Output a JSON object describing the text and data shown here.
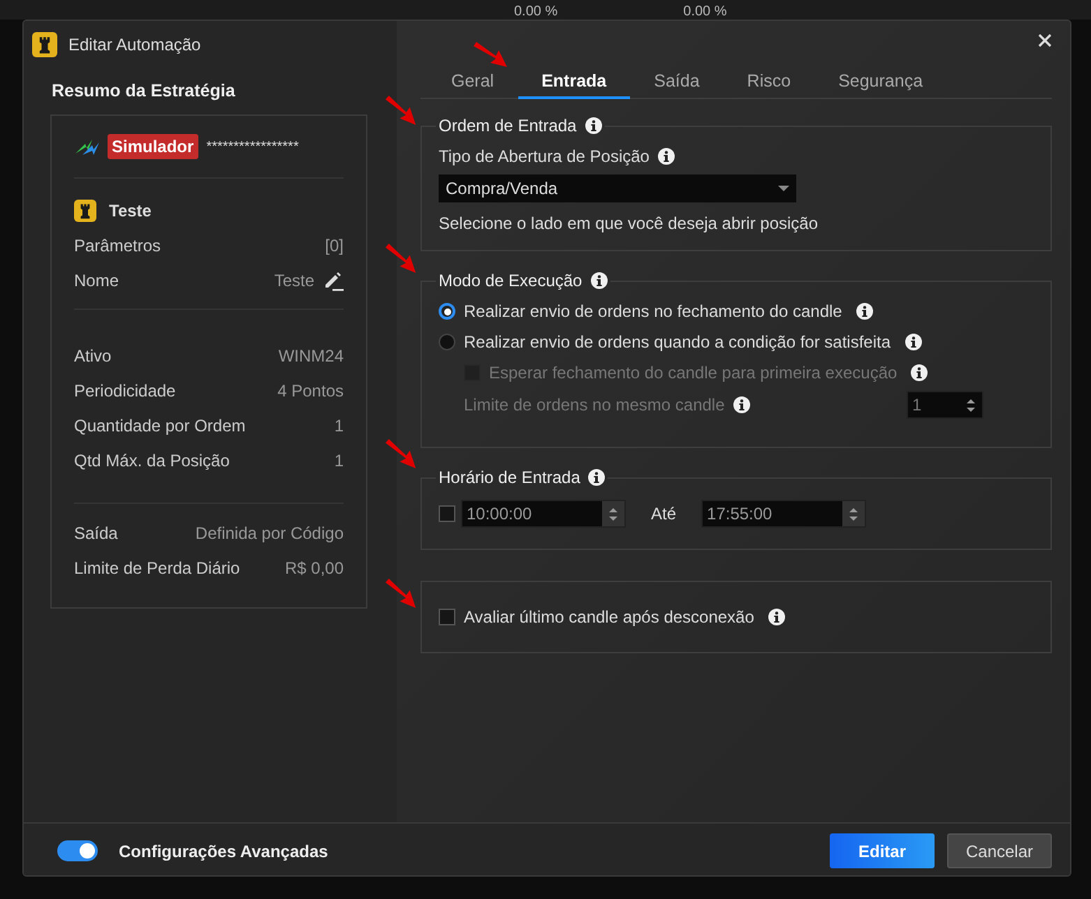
{
  "background": {
    "values": [
      "0.00 %",
      "0.00 %"
    ]
  },
  "window": {
    "title": "Editar Automação"
  },
  "summary": {
    "heading": "Resumo da Estratégia",
    "account_badge": "Simulador",
    "account_id": "*****************",
    "strategy_name": "Teste",
    "rows": [
      {
        "label": "Parâmetros",
        "value": "[0]",
        "kind": "plain"
      },
      {
        "label": "Nome",
        "value": "Teste",
        "kind": "editable"
      }
    ],
    "asset_rows": [
      {
        "label": "Ativo",
        "value": "WINM24"
      },
      {
        "label": "Periodicidade",
        "value": "4 Pontos"
      },
      {
        "label": "Quantidade por Ordem",
        "value": "1"
      },
      {
        "label": "Qtd Máx. da Posição",
        "value": "1"
      }
    ],
    "exit_rows": [
      {
        "label": "Saída",
        "value": "Definida por Código"
      },
      {
        "label": "Limite de Perda Diário",
        "value": "R$ 0,00"
      }
    ]
  },
  "tabs": [
    {
      "label": "Geral",
      "selected": false
    },
    {
      "label": "Entrada",
      "selected": true
    },
    {
      "label": "Saída",
      "selected": false
    },
    {
      "label": "Risco",
      "selected": false
    },
    {
      "label": "Segurança",
      "selected": false
    }
  ],
  "entry_order": {
    "title": "Ordem de Entrada",
    "field_label": "Tipo de Abertura de Posição",
    "select_value": "Compra/Venda",
    "hint": "Selecione o lado em que você deseja abrir posição"
  },
  "execution_mode": {
    "title": "Modo de Execução",
    "options": [
      {
        "label": "Realizar envio de ordens no fechamento do candle",
        "selected": true
      },
      {
        "label": "Realizar envio de ordens quando a condição for satisfeita",
        "selected": false
      }
    ],
    "wait_checkbox": {
      "label": "Esperar fechamento do candle para primeira execução",
      "checked": false,
      "disabled": true
    },
    "limit": {
      "label": "Limite de ordens no mesmo candle",
      "value": "1",
      "disabled": true
    }
  },
  "entry_time": {
    "title": "Horário de Entrada",
    "enabled": false,
    "start": "10:00:00",
    "separator": "Até",
    "end": "17:55:00"
  },
  "reconnect": {
    "label": "Avaliar último candle após desconexão",
    "checked": false
  },
  "footer": {
    "advanced": {
      "label": "Configurações Avançadas",
      "on": true
    },
    "buttons": [
      {
        "label": "Editar",
        "kind": "primary"
      },
      {
        "label": "Cancelar",
        "kind": "secondary"
      }
    ]
  }
}
